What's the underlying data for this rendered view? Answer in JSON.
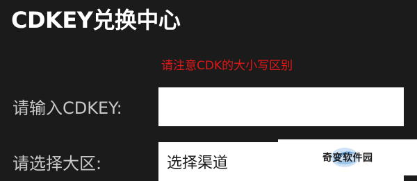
{
  "header": {
    "title": "CDKEY兑换中心"
  },
  "notice": {
    "text": "请注意CDK的大小写区别",
    "color": "#e01818"
  },
  "form": {
    "cdkey_label": "请输入CDKEY:",
    "cdkey_value": "",
    "region_label": "请选择大区:",
    "channel_selected": "选择渠道"
  },
  "watermark": {
    "text": "奇变软件园",
    "icon": "blue-swirl-logo"
  }
}
